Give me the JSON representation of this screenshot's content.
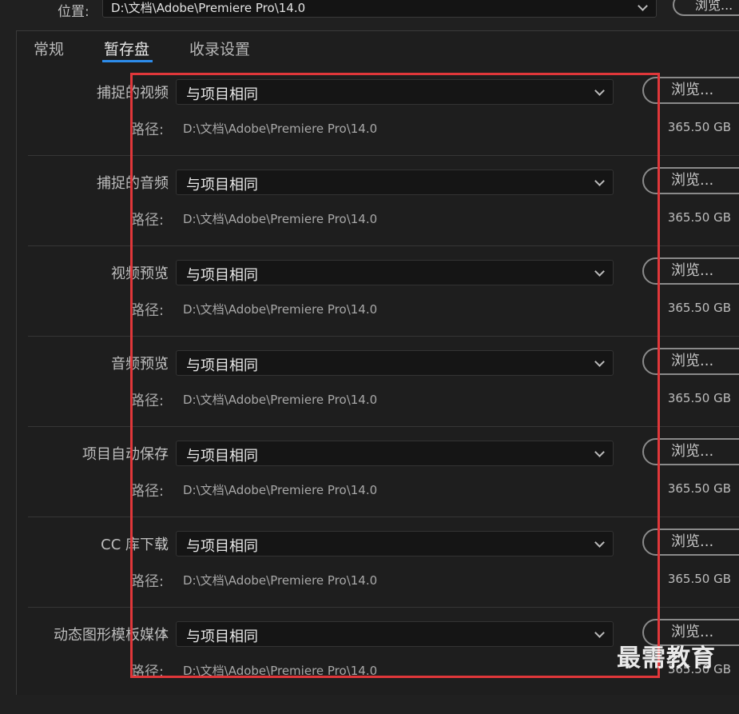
{
  "location": {
    "label": "位置:",
    "value": "D:\\文档\\Adobe\\Premiere Pro\\14.0",
    "browse_label": "浏览..."
  },
  "tabs": [
    {
      "label": "常规",
      "active": false
    },
    {
      "label": "暂存盘",
      "active": true
    },
    {
      "label": "收录设置",
      "active": false
    }
  ],
  "rows": [
    {
      "label": "捕捉的视频",
      "select_value": "与项目相同",
      "path_label": "路径:",
      "path": "D:\\文档\\Adobe\\Premiere Pro\\14.0",
      "space": "365.50 GB",
      "browse_label": "浏览..."
    },
    {
      "label": "捕捉的音频",
      "select_value": "与项目相同",
      "path_label": "路径:",
      "path": "D:\\文档\\Adobe\\Premiere Pro\\14.0",
      "space": "365.50 GB",
      "browse_label": "浏览..."
    },
    {
      "label": "视频预览",
      "select_value": "与项目相同",
      "path_label": "路径:",
      "path": "D:\\文档\\Adobe\\Premiere Pro\\14.0",
      "space": "365.50 GB",
      "browse_label": "浏览..."
    },
    {
      "label": "音频预览",
      "select_value": "与项目相同",
      "path_label": "路径:",
      "path": "D:\\文档\\Adobe\\Premiere Pro\\14.0",
      "space": "365.50 GB",
      "browse_label": "浏览..."
    },
    {
      "label": "项目自动保存",
      "select_value": "与项目相同",
      "path_label": "路径:",
      "path": "D:\\文档\\Adobe\\Premiere Pro\\14.0",
      "space": "365.50 GB",
      "browse_label": "浏览..."
    },
    {
      "label": "CC 库下载",
      "select_value": "与项目相同",
      "path_label": "路径:",
      "path": "D:\\文档\\Adobe\\Premiere Pro\\14.0",
      "space": "365.50 GB",
      "browse_label": "浏览..."
    },
    {
      "label": "动态图形模板媒体",
      "select_value": "与项目相同",
      "path_label": "路径:",
      "path": "D:\\文档\\Adobe\\Premiere Pro\\14.0",
      "space": "365.50 GB",
      "browse_label": "浏览..."
    }
  ],
  "colors": {
    "background": "#202020",
    "highlight": "#e0373a",
    "tab_accent": "#2d8ceb"
  },
  "watermark": "最需教育"
}
